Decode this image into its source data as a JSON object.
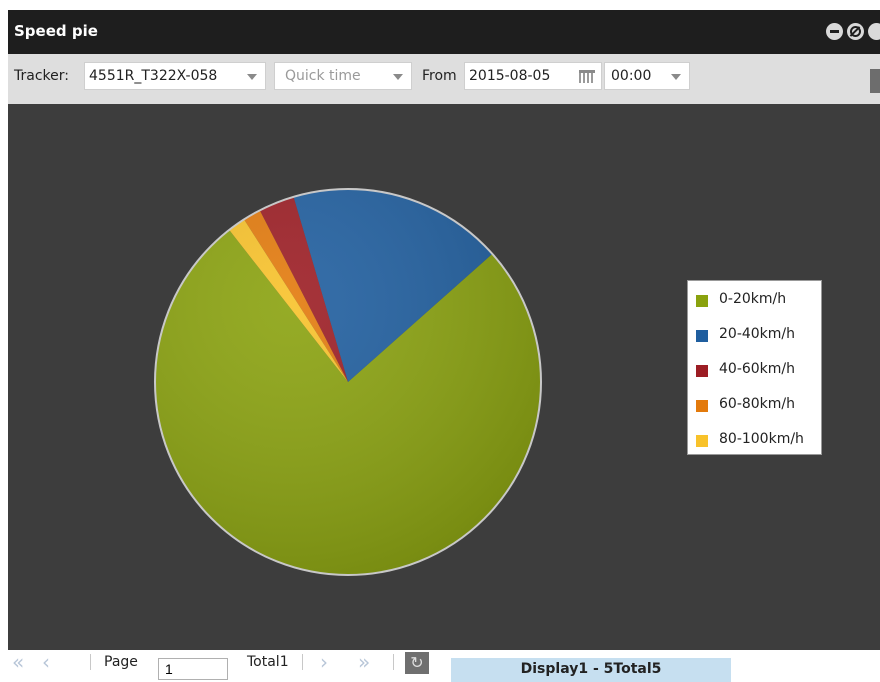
{
  "window": {
    "title": "Speed pie"
  },
  "toolbar": {
    "tracker_label": "Tracker:",
    "tracker_value": "4551R_T322X-058",
    "quick_time_placeholder": "Quick time",
    "from_label": "From",
    "from_date": "2015-08-05",
    "from_time": "00:00"
  },
  "chart_data": {
    "type": "pie",
    "title": "",
    "categories": [
      "0-20km/h",
      "20-40km/h",
      "40-60km/h",
      "60-80km/h",
      "80-100km/h"
    ],
    "values": [
      76,
      18,
      3,
      1.5,
      1.5
    ],
    "colors": [
      "#8aa20e",
      "#1f5e9f",
      "#9c1d24",
      "#e37a0c",
      "#f8c22a"
    ],
    "legend": "right"
  },
  "pager": {
    "page_label": "Page",
    "page_value": "1",
    "total_label": "Total1",
    "display_text": "Display1 - 5Total5"
  }
}
